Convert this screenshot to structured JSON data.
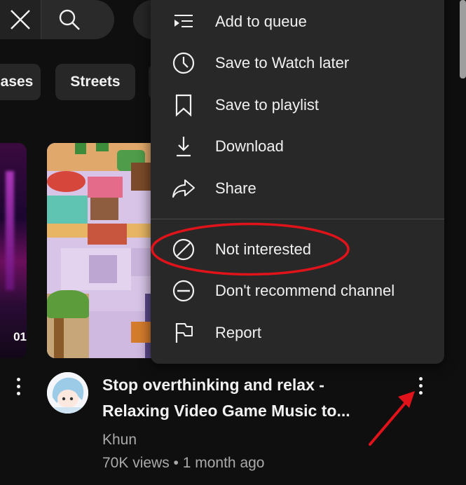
{
  "chips": [
    {
      "label": "ases"
    },
    {
      "label": "Streets"
    }
  ],
  "left_thumbnail": {
    "time_fragment": "01"
  },
  "video": {
    "title_line1": "Stop overthinking and relax -",
    "title_line2": "Relaxing Video Game Music to...",
    "channel": "Khun",
    "meta": "70K views • 1 month ago"
  },
  "menu": {
    "items": [
      {
        "label": "Add to queue",
        "icon": "add-to-queue-icon"
      },
      {
        "label": "Save to Watch later",
        "icon": "clock-icon"
      },
      {
        "label": "Save to playlist",
        "icon": "bookmark-icon"
      },
      {
        "label": "Download",
        "icon": "download-icon"
      },
      {
        "label": "Share",
        "icon": "share-icon"
      },
      {
        "label": "Not interested",
        "icon": "not-interested-icon"
      },
      {
        "label": "Don't recommend channel",
        "icon": "block-icon"
      },
      {
        "label": "Report",
        "icon": "flag-icon"
      }
    ]
  },
  "colors": {
    "background": "#0f0f0f",
    "menu": "#282828",
    "annotation": "#e0131a"
  }
}
